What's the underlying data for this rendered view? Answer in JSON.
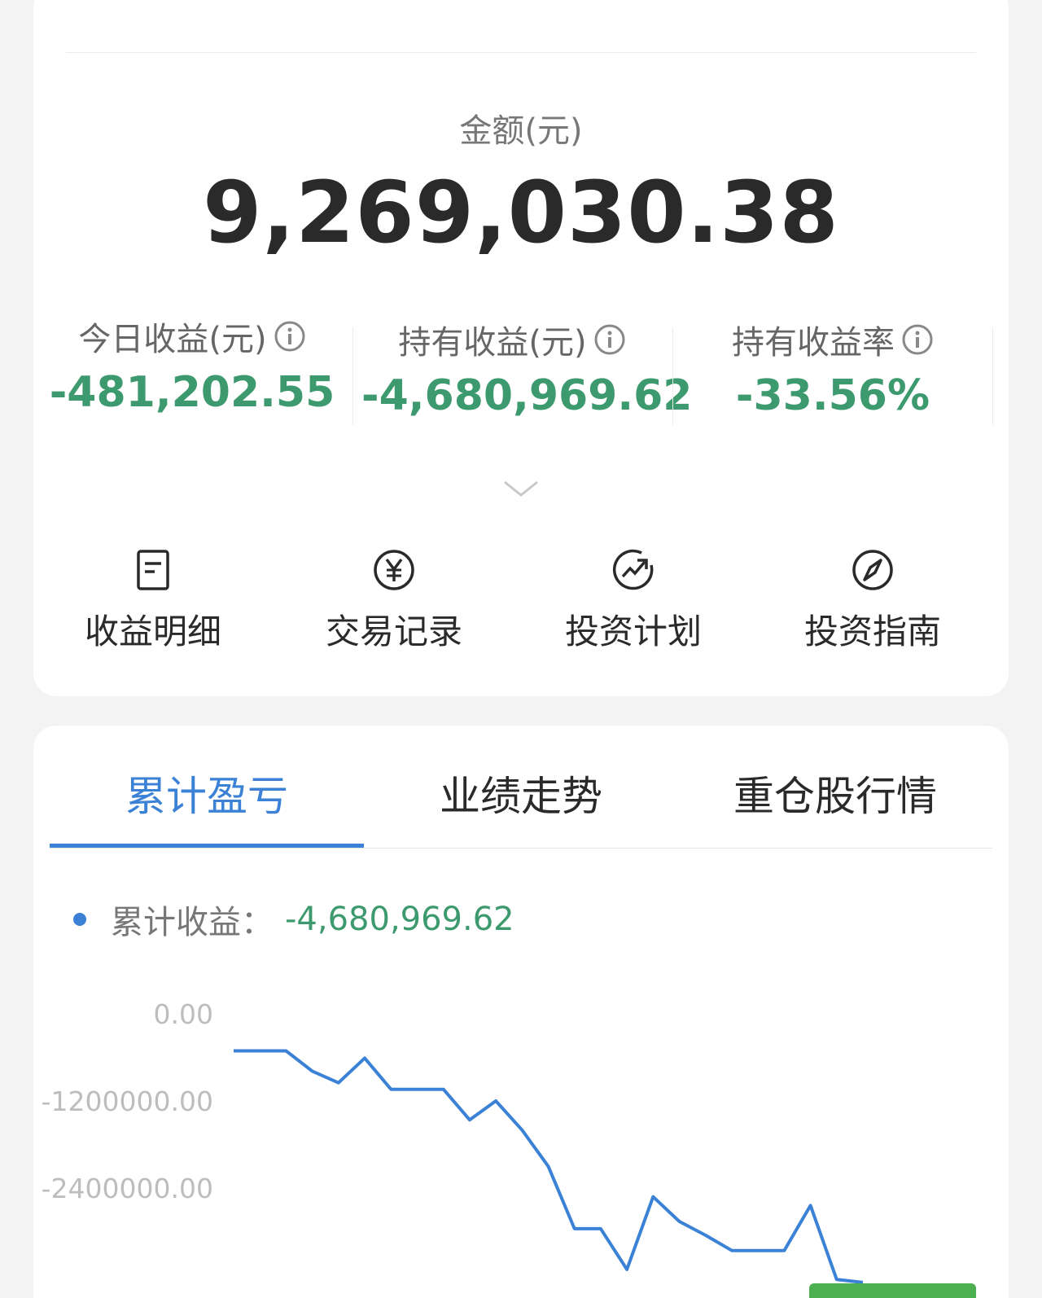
{
  "summary": {
    "amount_label": "金额(元)",
    "amount_value": "9,269,030.38"
  },
  "stats": [
    {
      "label": "今日收益(元)",
      "value": "-481,202.55"
    },
    {
      "label": "持有收益(元)",
      "value": "-4,680,969.62"
    },
    {
      "label": "持有收益率",
      "value": "-33.56%"
    }
  ],
  "actions": [
    {
      "label": "收益明细",
      "icon": "document-icon"
    },
    {
      "label": "交易记录",
      "icon": "yen-circle-icon"
    },
    {
      "label": "投资计划",
      "icon": "trend-up-icon"
    },
    {
      "label": "投资指南",
      "icon": "compass-icon"
    }
  ],
  "tabs": [
    {
      "label": "累计盈亏",
      "active": true
    },
    {
      "label": "业绩走势",
      "active": false
    },
    {
      "label": "重仓股行情",
      "active": false
    }
  ],
  "legend": {
    "label": "累计收益：",
    "value": "-4,680,969.62"
  },
  "colors": {
    "accent": "#3b82d6",
    "negative": "#3d9a6e"
  },
  "chart_data": {
    "type": "line",
    "yticks": [
      "0.00",
      "-1200000.00",
      "-2400000.00"
    ],
    "ylim": [
      -3700000,
      0
    ],
    "series": [
      {
        "values": [
          -510000,
          -510000,
          -510000,
          -790000,
          -950000,
          -610000,
          -1040000,
          -1040000,
          -1040000,
          -1460000,
          -1200000,
          -1600000,
          -2100000,
          -2960000,
          -2960000,
          -3520000,
          -2520000,
          -2860000,
          -3050000,
          -3260000,
          -3260000,
          -3260000,
          -2640000,
          -3660000,
          -3700000
        ]
      }
    ]
  }
}
